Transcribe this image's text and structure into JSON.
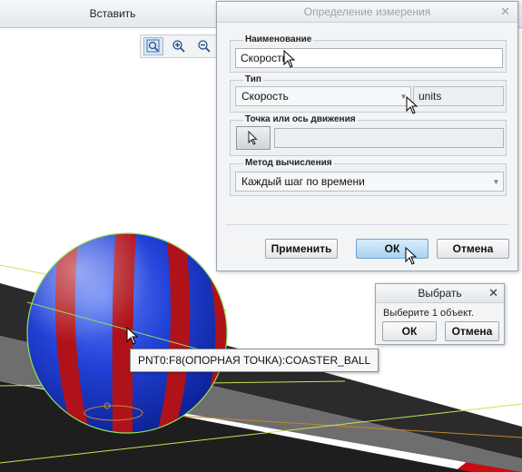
{
  "toolbar": {
    "insert_tab": "Вставить",
    "view_tools": [
      {
        "icon": "zoom-fit-icon"
      },
      {
        "icon": "zoom-in-icon"
      },
      {
        "icon": "zoom-out-icon"
      }
    ]
  },
  "tooltip": {
    "text": "PNT0:F8(ОПОРНАЯ ТОЧКА):COASTER_BALL"
  },
  "measure_dialog": {
    "title": "Определение измерения",
    "name_group": {
      "label": "Наименование",
      "value": "Скорость"
    },
    "type_group": {
      "label": "Тип",
      "selected": "Скорость",
      "units": "units"
    },
    "point_group": {
      "label": "Точка или ось движения",
      "value": ""
    },
    "method_group": {
      "label": "Метод вычисления",
      "selected": "Каждый шаг по времени"
    },
    "buttons": {
      "apply": "Применить",
      "ok": "ОК",
      "cancel": "Отмена"
    }
  },
  "select_dialog": {
    "title": "Выбрать",
    "prompt": "Выберите 1 объект.",
    "ok": "ОК",
    "cancel": "Отмена"
  },
  "colors": {
    "ball_blue": "#1f3fd6",
    "ball_red": "#b0121a",
    "track_dark": "#2b2b2b",
    "track_gray": "#6e6e6e",
    "ground_red": "#c70d12",
    "highlight_green": "#8fe05a",
    "tooltip_bg": "#f7f7f7",
    "ok_button": "#a9d3f1"
  }
}
